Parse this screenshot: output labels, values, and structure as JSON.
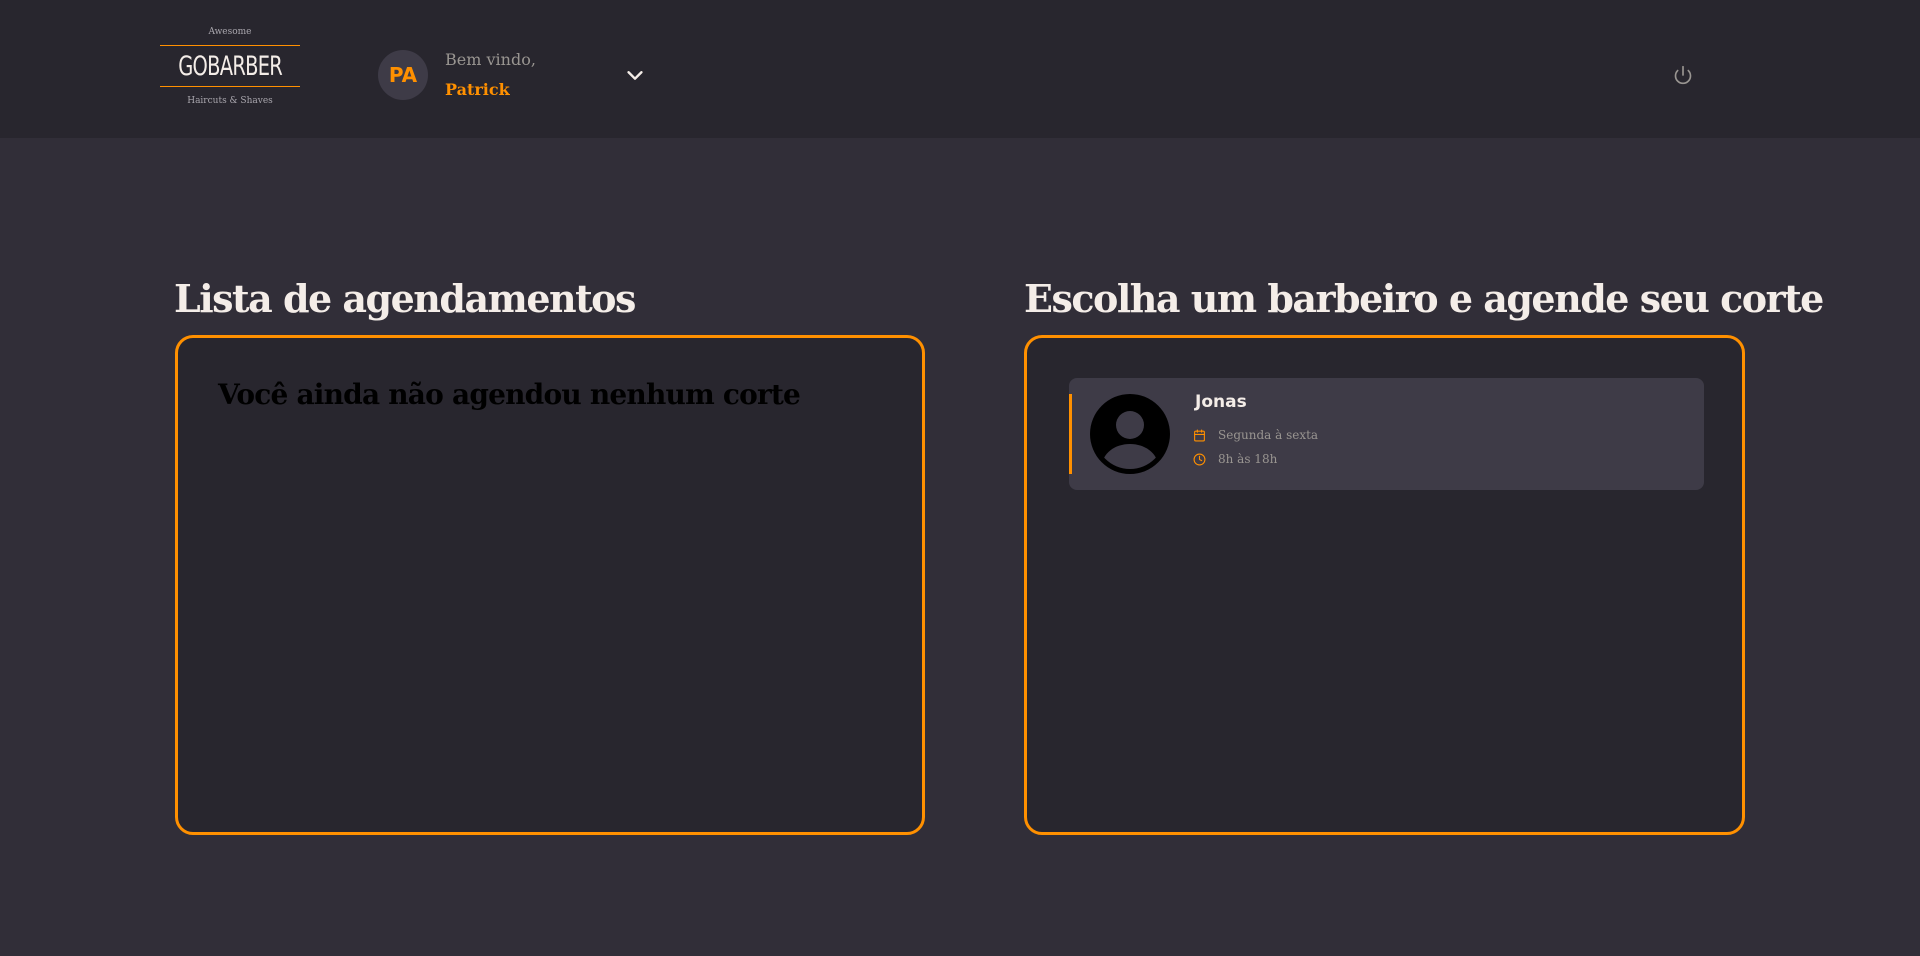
{
  "header": {
    "logo": {
      "top_text": "Awesome",
      "brand": "GOBARBER",
      "bottom_text": "Haircuts & Shaves"
    },
    "profile": {
      "initials": "PA",
      "welcome_label": "Bem vindo,",
      "user_name": "Patrick"
    },
    "icons": {
      "dropdown": "chevron-down-icon",
      "logout": "power-icon"
    }
  },
  "appointments": {
    "title": "Lista de agendamentos",
    "empty_message": "Você ainda não agendou nenhum corte"
  },
  "barbers": {
    "title": "Escolha um barbeiro e agende seu corte",
    "items": [
      {
        "name": "Jonas",
        "days": "Segunda à sexta",
        "hours": "8h às 18h"
      }
    ]
  },
  "colors": {
    "background": "#312e38",
    "header": "#28262e",
    "panel": "#28262e",
    "card": "#3e3b47",
    "accent": "#ff9000",
    "text": "#f4ede8",
    "muted": "#999591"
  }
}
